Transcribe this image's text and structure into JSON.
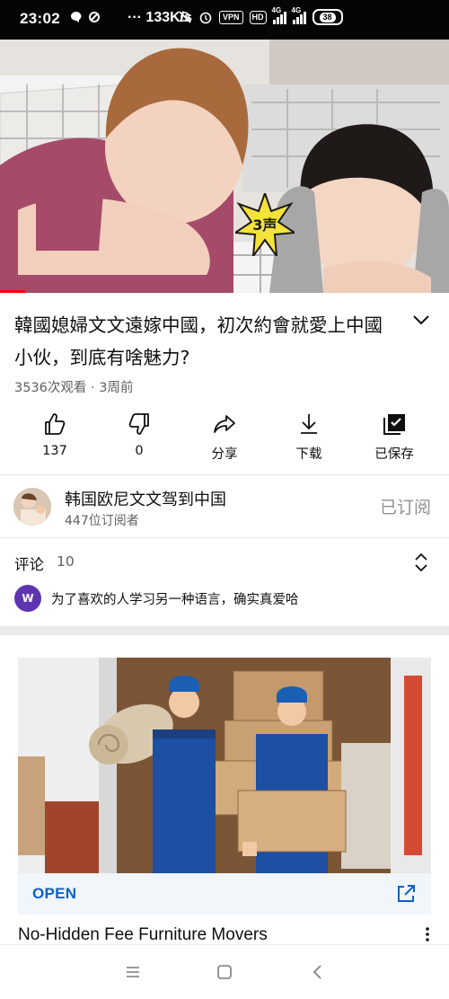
{
  "status_bar": {
    "time": "23:02",
    "network_speed": "··· 133K/s",
    "hd_label": "HD",
    "vpn_label": "VPN",
    "network_type_1": "4G",
    "network_type_2": "4G",
    "battery": "38"
  },
  "video": {
    "sticker_text": "3声",
    "progress": 0.056
  },
  "title": "韓國媳婦文文遠嫁中國，初次約會就愛上中國小伙，到底有啥魅力?",
  "meta": "3536次观看 · 3周前",
  "actions": [
    {
      "label": "137",
      "icon": "thumbs-up-icon"
    },
    {
      "label": "0",
      "icon": "thumbs-down-icon"
    },
    {
      "label": "分享",
      "icon": "share-icon"
    },
    {
      "label": "下载",
      "icon": "download-icon"
    },
    {
      "label": "已保存",
      "icon": "saved-playlist-icon"
    }
  ],
  "channel": {
    "name": "韩国欧尼文文驾到中国",
    "subscribers": "447位订阅者",
    "subscribe_state": "已订阅"
  },
  "comments": {
    "heading": "评论",
    "count": "10",
    "top_comment_avatar": "W",
    "top_comment": "为了喜欢的人学习另一种语言，确实真爱哈"
  },
  "ad": {
    "cta": "OPEN",
    "title": "No-Hidden Fee Furniture Movers"
  },
  "colors": {
    "accent_red": "#ff0000",
    "link_blue": "#0b62c9",
    "comment_avatar": "#5e35b1"
  }
}
